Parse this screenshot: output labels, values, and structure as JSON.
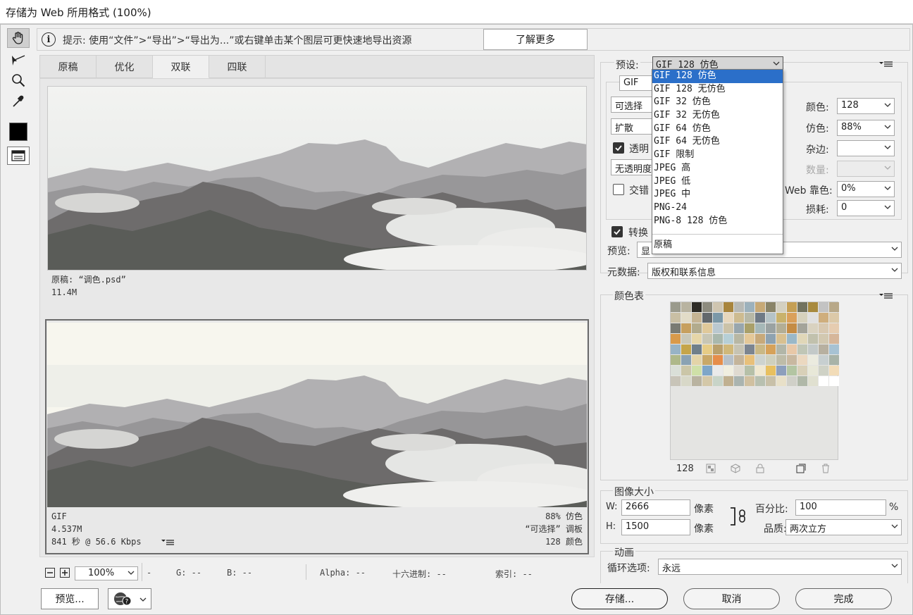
{
  "window": {
    "title": "存储为 Web 所用格式 (100%)"
  },
  "hint": {
    "text": "提示: 使用“文件”>“导出”>“导出为...”或右键单击某个图层可更快速地导出资源",
    "learn_more": "了解更多"
  },
  "tabs": [
    "原稿",
    "优化",
    "双联",
    "四联"
  ],
  "original": {
    "line1": "原稿: “调色.psd”",
    "line2": "11.4M"
  },
  "optimized": {
    "format": "GIF",
    "size": "4.537M",
    "time": "841 秒 @ 56.6 Kbps",
    "dither": "88% 仿色",
    "palette": "“可选择” 调板",
    "colors": "128 颜色"
  },
  "zoom": {
    "value": "100%"
  },
  "status": {
    "r": "-",
    "g": "G: --",
    "b": "B: --",
    "alpha": "Alpha: --",
    "hex": "十六进制: --",
    "index": "索引: --"
  },
  "buttons": {
    "preview": "预览...",
    "save": "存储...",
    "cancel": "取消",
    "done": "完成"
  },
  "preset": {
    "label": "预设:",
    "value": "GIF 128 仿色",
    "options": [
      "GIF 128 仿色",
      "GIF 128 无仿色",
      "GIF 32 仿色",
      "GIF 32 无仿色",
      "GIF 64 仿色",
      "GIF 64 无仿色",
      "GIF 限制",
      "JPEG 高",
      "JPEG 低",
      "JPEG 中",
      "PNG-24",
      "PNG-8 128 仿色"
    ],
    "extra_option": "原稿"
  },
  "settings": {
    "format": "GIF",
    "reduction": "可选择",
    "dither_algo": "扩散",
    "transparency": "透明",
    "matte_mode": "无透明度",
    "interlaced": "交错",
    "colors_label": "颜色:",
    "colors_value": "128",
    "dither_label": "仿色:",
    "dither_value": "88%",
    "matte_label": "杂边:",
    "amount_label": "数量:",
    "web_snap_label": "Web 靠色:",
    "web_snap_value": "0%",
    "lossy_label": "损耗:",
    "lossy_value": "0",
    "convert": "转换",
    "preview_label": "预览:",
    "preview_value": "显",
    "metadata_label": "元数据:",
    "metadata_value": "版权和联系信息"
  },
  "color_table": {
    "title": "颜色表",
    "count": "128",
    "swatches": [
      "#9a9a8c",
      "#b8b3a0",
      "#2e2c26",
      "#8d8b7e",
      "#cfc5b0",
      "#a8853d",
      "#b7b9b5",
      "#9cb1bc",
      "#c7a976",
      "#8a8468",
      "#d4d0c0",
      "#c59f54",
      "#72725e",
      "#a88a3e",
      "#c3c3c3",
      "#b8a888",
      "#c9bfa4",
      "#e2dcc8",
      "#c5b493",
      "#63686c",
      "#7b98a8",
      "#e7d7bd",
      "#cdbb90",
      "#b7b8a6",
      "#6f7a86",
      "#b5c3c7",
      "#c9b26c",
      "#daa05a",
      "#d6d1bc",
      "#e0e0e0",
      "#cfae7d",
      "#dcc9a8",
      "#7a7b73",
      "#c7a05e",
      "#b2ab8d",
      "#e0c99a",
      "#bac8d0",
      "#cbc2a8",
      "#98a6ad",
      "#a9a06a",
      "#a6b8b8",
      "#9aa2a2",
      "#b3ae95",
      "#c48c45",
      "#a4a49a",
      "#d9d2c0",
      "#d8c8b0",
      "#e6ccb0",
      "#d99a4b",
      "#c9c8b8",
      "#e6d6a8",
      "#c8c6b4",
      "#a9b8ad",
      "#b6cfd6",
      "#b8b7a3",
      "#e4c898",
      "#c7a97a",
      "#8ea2b0",
      "#d8c090",
      "#9ab8c8",
      "#e0d7b8",
      "#c1c1ad",
      "#d2c8b0",
      "#d6b69a",
      "#97b3c6",
      "#c5a54a",
      "#6f7f8a",
      "#e6cc86",
      "#b9a06c",
      "#d0b87a",
      "#c6c3b3",
      "#7c8590",
      "#c9b886",
      "#d6a25a",
      "#b2b6a8",
      "#e8c8a8",
      "#c0c6b6",
      "#c3c9c8",
      "#b7b0a0",
      "#a7c2d3",
      "#aeb88a",
      "#8aa2b3",
      "#e3d4a8",
      "#c8a868",
      "#e68d4a",
      "#b7c0c8",
      "#c4b49a",
      "#e8c07a",
      "#cdd3cf",
      "#cfd0bd",
      "#bebca8",
      "#c8b8a0",
      "#ebd8c0",
      "#ebebdf",
      "#c7cfd0",
      "#a8b3a8",
      "#dadfd8",
      "#cbc6a8",
      "#cfe0a8",
      "#7ea6c8",
      "#eaeaea",
      "#f0eee0",
      "#dfdad0",
      "#b6c0a8",
      "#f0e8d0",
      "#e8c060",
      "#8d9fbc",
      "#b3c5a2",
      "#d8d0b8",
      "#e8e8d8",
      "#cfd2c6",
      "#f2dcb8",
      "#c8c4b8",
      "#d8d8c8",
      "#b9b3a0",
      "#d4c8a8",
      "#c8d4c8",
      "#c0b090",
      "#aab4b0",
      "#d0c0a0",
      "#b8c0b0",
      "#c8c0a8",
      "#e8e0c8",
      "#d0d0c8",
      "#b0b8a8",
      "#e0e0d0",
      "#ffffff",
      "#ffffff"
    ]
  },
  "image_size": {
    "title": "图像大小",
    "w_label": "W:",
    "w_value": "2666",
    "w_unit": "像素",
    "h_label": "H:",
    "h_value": "1500",
    "h_unit": "像素",
    "percent_label": "百分比:",
    "percent_value": "100",
    "percent_unit": "%",
    "quality_label": "品质:",
    "quality_value": "两次立方"
  },
  "animation": {
    "title": "动画",
    "loop_label": "循环选项:",
    "loop_value": "永远"
  }
}
